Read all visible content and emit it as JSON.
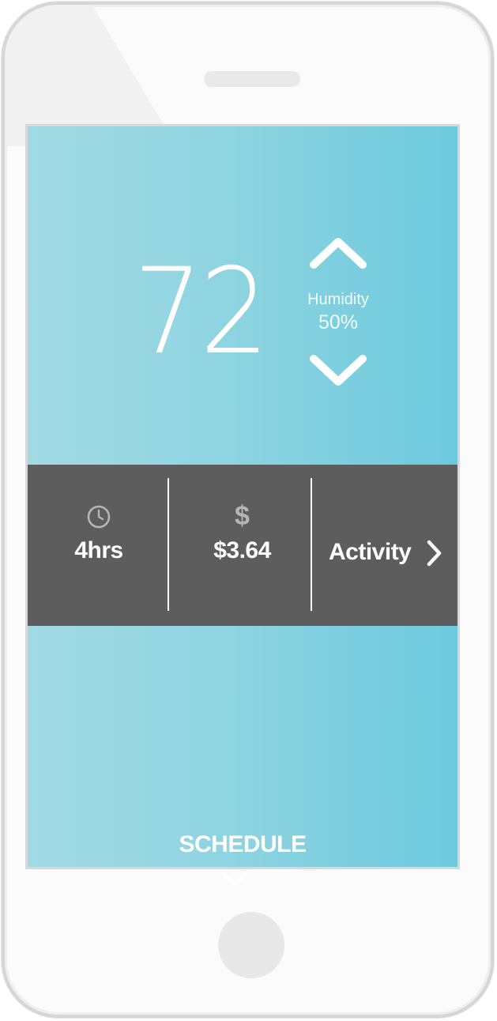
{
  "thermostat": {
    "temperature": "72",
    "humidity_label": "Humidity",
    "humidity_value": "50%"
  },
  "stats": {
    "runtime_icon": "clock-icon",
    "runtime_value": "4hrs",
    "cost_icon": "dollar-icon",
    "cost_symbol": "$",
    "cost_value": "$3.64",
    "activity_label": "Activity",
    "activity_icon": "chevron-right-icon"
  },
  "schedule": {
    "label": "SCHEDULE",
    "icon": "chevron-down-icon"
  },
  "colors": {
    "screen_gradient_left": "#a2dbe4",
    "screen_gradient_right": "#6ccadd",
    "stats_bar": "#5d5d5d",
    "text": "#ffffff",
    "icon_gray": "#b5b5b5"
  }
}
